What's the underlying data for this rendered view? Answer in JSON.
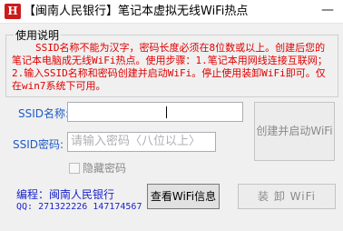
{
  "window": {
    "icon_text": "H",
    "title": "【闽南人民银行】笔记本虚拟无线WiFi热点",
    "minimize_glyph": "—"
  },
  "usage": {
    "legend": "使用说明",
    "text": "SSID名称不能为汉字，密码长度必须在8位数或以上。创建后您的笔记本电脑成无线WiFi热点。使用步骤：1.笔记本用网线连接互联网；2.输入SSID名称和密码创建并启动WiFi。停止使用装卸WiFi即可。仅在win7系统下可用。"
  },
  "form": {
    "ssid_label": "SSID名称:",
    "ssid_value": "",
    "password_label": "SSID密码:",
    "password_value": "",
    "password_placeholder": "请输入密码〈八位以上〉",
    "hide_password_label": "隐藏密码",
    "hide_password_checked": false
  },
  "buttons": {
    "create_start": "创建并启动WiFi",
    "view_info": "查看WiFi信息",
    "uninstall": "装 卸 WiFi"
  },
  "footer": {
    "author": "编程：闽南人民银行",
    "qq": "QQ: 271322226 147174567"
  }
}
